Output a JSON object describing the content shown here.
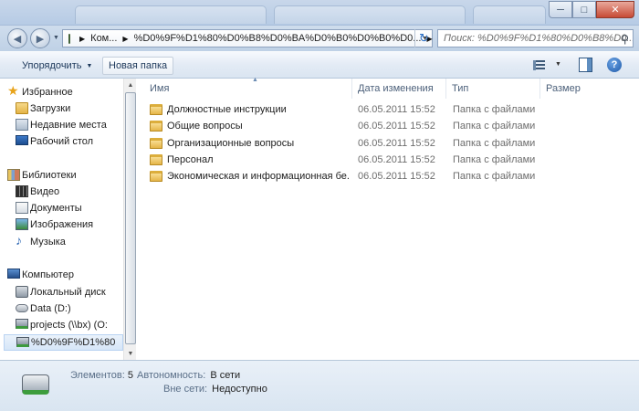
{
  "window": {
    "buttons": {
      "minimize": "─",
      "maximize": "□",
      "close": "✕"
    }
  },
  "nav": {
    "back": "◀",
    "forward": "▶",
    "dropdown": "▼",
    "address": {
      "crumbs": [
        "Ком...",
        "%D0%9F%D1%80%D0%B8%D0%BA%D0%B0%D0%B0%D0..."
      ],
      "separator": "▶",
      "dropdown": "▼"
    },
    "refresh": "↻",
    "search_placeholder": "Поиск: %D0%9F%D1%80%D0%B8%D0..."
  },
  "toolbar": {
    "organize_label": "Упорядочить",
    "new_folder_label": "Новая папка",
    "view_caret": "▼",
    "help": "?"
  },
  "sidebar": {
    "items": [
      {
        "label": "Избранное",
        "icon": "star-icon"
      },
      {
        "label": "Загрузки",
        "icon": "downloads-folder-icon"
      },
      {
        "label": "Недавние места",
        "icon": "recent-places-icon"
      },
      {
        "label": "Рабочий стол",
        "icon": "desktop-icon"
      },
      {
        "label": "Библиотеки",
        "icon": "libraries-icon"
      },
      {
        "label": "Видео",
        "icon": "video-icon"
      },
      {
        "label": "Документы",
        "icon": "documents-icon"
      },
      {
        "label": "Изображения",
        "icon": "pictures-icon"
      },
      {
        "label": "Музыка",
        "icon": "music-icon"
      },
      {
        "label": "Компьютер",
        "icon": "computer-icon"
      },
      {
        "label": "Локальный диск",
        "icon": "local-disk-icon"
      },
      {
        "label": "Data (D:)",
        "icon": "data-disk-icon"
      },
      {
        "label": "projects (\\\\bx) (O:",
        "icon": "network-drive-icon"
      },
      {
        "label": "%D0%9F%D1%80",
        "icon": "network-drive-icon"
      }
    ],
    "scroll_up": "▲",
    "scroll_down": "▼"
  },
  "columns": {
    "name": "Имя",
    "date": "Дата изменения",
    "type": "Тип",
    "size": "Размер",
    "sort_indicator": "▲"
  },
  "files": [
    {
      "name": "Должностные инструкции",
      "date": "06.05.2011 15:52",
      "type": "Папка с файлами"
    },
    {
      "name": "Общие вопросы",
      "date": "06.05.2011 15:52",
      "type": "Папка с файлами"
    },
    {
      "name": "Организационные вопросы",
      "date": "06.05.2011 15:52",
      "type": "Папка с файлами"
    },
    {
      "name": "Персонал",
      "date": "06.05.2011 15:52",
      "type": "Папка с файлами"
    },
    {
      "name": "Экономическая и информационная бе...",
      "date": "06.05.2011 15:52",
      "type": "Папка с файлами"
    }
  ],
  "details": {
    "items_label": "Элементов:",
    "items_value": "5",
    "offline_label": "Автономность:",
    "offline_value": "В сети",
    "offline_state_label": "Вне сети:",
    "offline_state_value": "Недоступно"
  }
}
